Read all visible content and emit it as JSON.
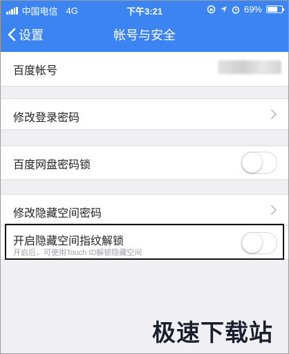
{
  "status_bar": {
    "carrier": "中国电信",
    "network": "4G",
    "time": "下午3:21",
    "battery_percent": "69%",
    "battery_level": 0.69,
    "icons": [
      "signal-icon",
      "rotation-lock-icon",
      "location-icon",
      "alarm-icon",
      "battery-icon"
    ]
  },
  "nav": {
    "back_label": "设置",
    "title": "帐号与安全"
  },
  "rows": {
    "account": {
      "label": "百度帐号",
      "value_masked": true
    },
    "change_login_password": {
      "label": "修改登录密码"
    },
    "netdisk_password_lock": {
      "label": "百度网盘密码锁",
      "toggle_on": false
    },
    "change_hidden_space_password": {
      "label": "修改隐藏空间密码"
    },
    "hidden_space_fingerprint": {
      "label": "开启隐藏空间指纹解锁",
      "sublabel": "开启后，可使用Touch ID解锁隐藏空间",
      "toggle_on": false
    }
  },
  "watermark": "极速下载站",
  "colors": {
    "nav_blue": "#3b84f1",
    "background": "#efeff4"
  }
}
